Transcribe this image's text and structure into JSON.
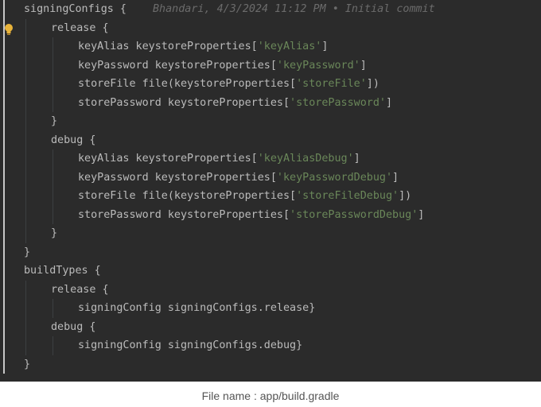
{
  "editor": {
    "blame": "Bhandari, 4/3/2024 11:12 PM • Initial commit",
    "lines": [
      {
        "i": 0,
        "parts": [
          {
            "t": "signingConfigs {",
            "c": "plain"
          }
        ]
      },
      {
        "i": 1,
        "parts": [
          {
            "t": "release {",
            "c": "plain"
          }
        ]
      },
      {
        "i": 2,
        "parts": [
          {
            "t": "keyAlias keystoreProperties[",
            "c": "plain"
          },
          {
            "t": "'keyAlias'",
            "c": "str"
          },
          {
            "t": "]",
            "c": "plain"
          }
        ]
      },
      {
        "i": 2,
        "parts": [
          {
            "t": "keyPassword keystoreProperties[",
            "c": "plain"
          },
          {
            "t": "'keyPassword'",
            "c": "str"
          },
          {
            "t": "]",
            "c": "plain"
          }
        ]
      },
      {
        "i": 2,
        "parts": [
          {
            "t": "storeFile file(keystoreProperties[",
            "c": "plain"
          },
          {
            "t": "'storeFile'",
            "c": "str"
          },
          {
            "t": "])",
            "c": "plain"
          }
        ]
      },
      {
        "i": 2,
        "parts": [
          {
            "t": "storePassword keystoreProperties[",
            "c": "plain"
          },
          {
            "t": "'storePassword'",
            "c": "str"
          },
          {
            "t": "]",
            "c": "plain"
          }
        ]
      },
      {
        "i": 1,
        "parts": [
          {
            "t": "}",
            "c": "plain"
          }
        ]
      },
      {
        "i": 1,
        "parts": [
          {
            "t": "debug {",
            "c": "plain"
          }
        ]
      },
      {
        "i": 2,
        "parts": [
          {
            "t": "keyAlias keystoreProperties[",
            "c": "plain"
          },
          {
            "t": "'keyAliasDebug'",
            "c": "str"
          },
          {
            "t": "]",
            "c": "plain"
          }
        ]
      },
      {
        "i": 2,
        "parts": [
          {
            "t": "keyPassword keystoreProperties[",
            "c": "plain"
          },
          {
            "t": "'keyPasswordDebug'",
            "c": "str"
          },
          {
            "t": "]",
            "c": "plain"
          }
        ]
      },
      {
        "i": 2,
        "parts": [
          {
            "t": "storeFile file(keystoreProperties[",
            "c": "plain"
          },
          {
            "t": "'storeFileDebug'",
            "c": "str"
          },
          {
            "t": "])",
            "c": "plain"
          }
        ]
      },
      {
        "i": 2,
        "parts": [
          {
            "t": "storePassword keystoreProperties[",
            "c": "plain"
          },
          {
            "t": "'storePasswordDebug'",
            "c": "str"
          },
          {
            "t": "]",
            "c": "plain"
          }
        ]
      },
      {
        "i": 1,
        "parts": [
          {
            "t": "}",
            "c": "plain"
          }
        ]
      },
      {
        "i": 0,
        "parts": [
          {
            "t": "}",
            "c": "plain"
          }
        ]
      },
      {
        "i": 0,
        "parts": [
          {
            "t": "buildTypes {",
            "c": "plain"
          }
        ]
      },
      {
        "i": 1,
        "parts": [
          {
            "t": "release {",
            "c": "plain"
          }
        ]
      },
      {
        "i": 2,
        "parts": [
          {
            "t": "signingConfig signingConfigs.release}",
            "c": "plain"
          }
        ]
      },
      {
        "i": 1,
        "parts": [
          {
            "t": "debug {",
            "c": "plain"
          }
        ]
      },
      {
        "i": 2,
        "parts": [
          {
            "t": "signingConfig signingConfigs.debug}",
            "c": "plain"
          }
        ]
      },
      {
        "i": 0,
        "parts": [
          {
            "t": "}",
            "c": "plain"
          }
        ]
      }
    ]
  },
  "caption": "File name : app/build.gradle",
  "icons": {
    "gutter": "lightbulb-icon"
  },
  "colors": {
    "background": "#2b2b2b",
    "text": "#bbbbbb",
    "string": "#6a8759",
    "blame": "#6b6b6b"
  }
}
